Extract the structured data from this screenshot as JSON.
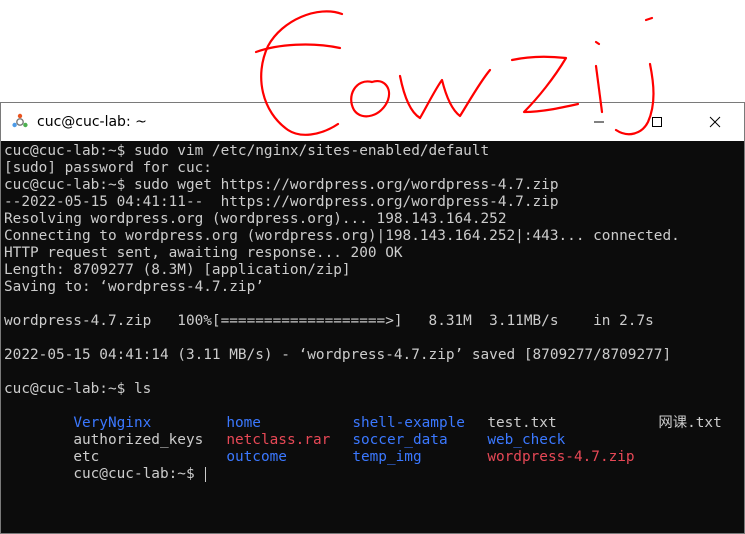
{
  "window": {
    "title": "cuc@cuc-lab: ~"
  },
  "terminal": {
    "lines": [
      "cuc@cuc-lab:~$ sudo vim /etc/nginx/sites-enabled/default",
      "[sudo] password for cuc:",
      "cuc@cuc-lab:~$ sudo wget https://wordpress.org/wordpress-4.7.zip",
      "--2022-05-15 04:41:11--  https://wordpress.org/wordpress-4.7.zip",
      "Resolving wordpress.org (wordpress.org)... 198.143.164.252",
      "Connecting to wordpress.org (wordpress.org)|198.143.164.252|:443... connected.",
      "HTTP request sent, awaiting response... 200 OK",
      "Length: 8709277 (8.3M) [application/zip]",
      "Saving to: ‘wordpress-4.7.zip’",
      "",
      "wordpress-4.7.zip   100%[===================>]   8.31M  3.11MB/s    in 2.7s",
      "",
      "2022-05-15 04:41:14 (3.11 MB/s) - ‘wordpress-4.7.zip’ saved [8709277/8709277]",
      "",
      "cuc@cuc-lab:~$ ls"
    ],
    "ls_rows": [
      [
        {
          "name": "VeryNginx",
          "color": "#3b78ff"
        },
        {
          "name": "home",
          "color": "#3b78ff"
        },
        {
          "name": "shell-example",
          "color": "#3b78ff"
        },
        {
          "name": "test.txt",
          "color": "#cccccc"
        },
        {
          "name": "网课.txt",
          "color": "#cccccc"
        }
      ],
      [
        {
          "name": "authorized_keys",
          "color": "#cccccc"
        },
        {
          "name": "netclass.rar",
          "color": "#e74856"
        },
        {
          "name": "soccer_data",
          "color": "#3b78ff"
        },
        {
          "name": "web_check",
          "color": "#3b78ff"
        },
        {
          "name": "",
          "color": "#cccccc"
        }
      ],
      [
        {
          "name": "etc",
          "color": "#cccccc"
        },
        {
          "name": "outcome",
          "color": "#3b78ff"
        },
        {
          "name": "temp_img",
          "color": "#3b78ff"
        },
        {
          "name": "wordpress-4.7.zip",
          "color": "#e74856"
        },
        {
          "name": "",
          "color": "#cccccc"
        }
      ]
    ],
    "prompt": "cuc@cuc-lab:~$ "
  },
  "colors": {
    "terminal_bg": "#0c0c0c",
    "terminal_fg": "#cccccc",
    "directory": "#3b78ff",
    "archive": "#e74856",
    "signature_ink": "#ff0000"
  },
  "icons": [
    "ubuntu-app-icon",
    "minimize-icon",
    "maximize-icon",
    "close-icon"
  ]
}
